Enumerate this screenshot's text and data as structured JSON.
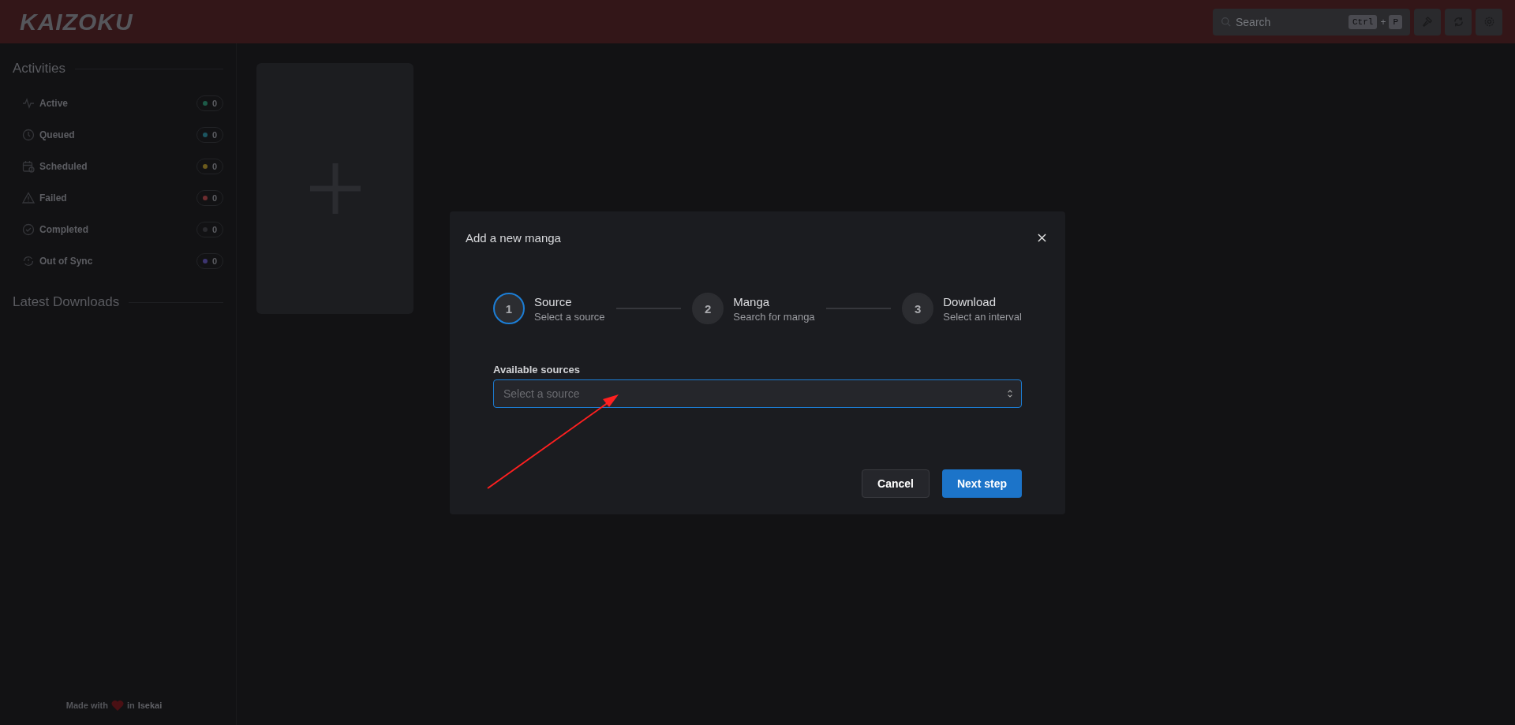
{
  "header": {
    "logo": "KAIZOKU",
    "search": {
      "placeholder": "Search",
      "keys": [
        "Ctrl",
        "+",
        "P"
      ]
    }
  },
  "sidebar": {
    "activities_title": "Activities",
    "activities": [
      {
        "kind": "active",
        "label": "Active",
        "count": "0",
        "color": "#1d5a48"
      },
      {
        "kind": "queued",
        "label": "Queued",
        "count": "0",
        "color": "#1c5560"
      },
      {
        "kind": "scheduled",
        "label": "Scheduled",
        "count": "0",
        "color": "#6b5a1c"
      },
      {
        "kind": "failed",
        "label": "Failed",
        "count": "0",
        "color": "#6e2d30"
      },
      {
        "kind": "completed",
        "label": "Completed",
        "count": "0",
        "color": "#2a2a2e"
      },
      {
        "kind": "sync",
        "label": "Out of Sync",
        "count": "0",
        "color": "#3d3570"
      }
    ],
    "latest_title": "Latest Downloads",
    "footer": {
      "before": "Made with",
      "after": "in",
      "brand": "Isekai"
    }
  },
  "dialog": {
    "title": "Add a new manga",
    "steps": [
      {
        "number": "1",
        "label": "Source",
        "description": "Select a source",
        "active": true
      },
      {
        "number": "2",
        "label": "Manga",
        "description": "Search for manga",
        "active": false
      },
      {
        "number": "3",
        "label": "Download",
        "description": "Select an interval",
        "active": false
      }
    ],
    "field_label": "Available sources",
    "placeholder": "Select a source",
    "buttons": [
      {
        "kind": "secondary",
        "label": "Cancel"
      },
      {
        "kind": "primary",
        "label": "Next step"
      }
    ]
  }
}
